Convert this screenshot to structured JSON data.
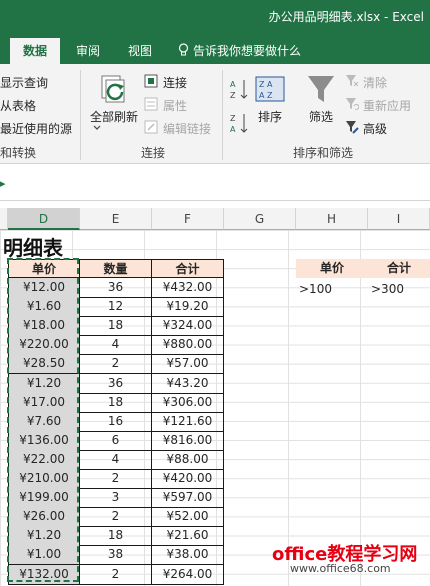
{
  "window": {
    "title": "办公用品明细表.xlsx - Excel"
  },
  "tabs": [
    {
      "label": "数据",
      "active": true
    },
    {
      "label": "审阅",
      "active": false
    },
    {
      "label": "视图",
      "active": false
    }
  ],
  "tell_me": "告诉我你想要做什么",
  "ribbon": {
    "get_transform": {
      "items": [
        "显示查询",
        "从表格",
        "最近使用的源"
      ],
      "group_label": "和转换"
    },
    "connections": {
      "refresh_all": "全部刷新",
      "connections": "连接",
      "properties": "属性",
      "edit_links": "编辑链接",
      "group_label": "连接"
    },
    "sort_filter": {
      "sort": "排序",
      "filter": "筛选",
      "clear": "清除",
      "reapply": "重新应用",
      "advanced": "高级",
      "group_label": "排序和筛选"
    }
  },
  "columns": [
    "D",
    "E",
    "F",
    "G",
    "H",
    "I"
  ],
  "sheet": {
    "heading": "明细表",
    "table_headers": [
      "单价",
      "数量",
      "合计"
    ],
    "rows": [
      [
        "¥12.00",
        "36",
        "¥432.00"
      ],
      [
        "¥1.60",
        "12",
        "¥19.20"
      ],
      [
        "¥18.00",
        "18",
        "¥324.00"
      ],
      [
        "¥220.00",
        "4",
        "¥880.00"
      ],
      [
        "¥28.50",
        "2",
        "¥57.00"
      ],
      [
        "¥1.20",
        "36",
        "¥43.20"
      ],
      [
        "¥17.00",
        "18",
        "¥306.00"
      ],
      [
        "¥7.60",
        "16",
        "¥121.60"
      ],
      [
        "¥136.00",
        "6",
        "¥816.00"
      ],
      [
        "¥22.00",
        "4",
        "¥88.00"
      ],
      [
        "¥210.00",
        "2",
        "¥420.00"
      ],
      [
        "¥199.00",
        "3",
        "¥597.00"
      ],
      [
        "¥26.00",
        "2",
        "¥52.00"
      ],
      [
        "¥1.20",
        "18",
        "¥21.60"
      ],
      [
        "¥1.00",
        "38",
        "¥38.00"
      ],
      [
        "¥132.00",
        "2",
        "¥264.00"
      ]
    ],
    "criteria_headers": [
      "单价",
      "合计"
    ],
    "criteria_values": [
      ">100",
      ">300"
    ]
  },
  "watermark": {
    "main": "office教程学习网",
    "sub": "www.office68.com"
  },
  "colors": {
    "accent": "#217346",
    "header_fill": "#fce4d6",
    "selected_fill": "#d9d9d9"
  }
}
